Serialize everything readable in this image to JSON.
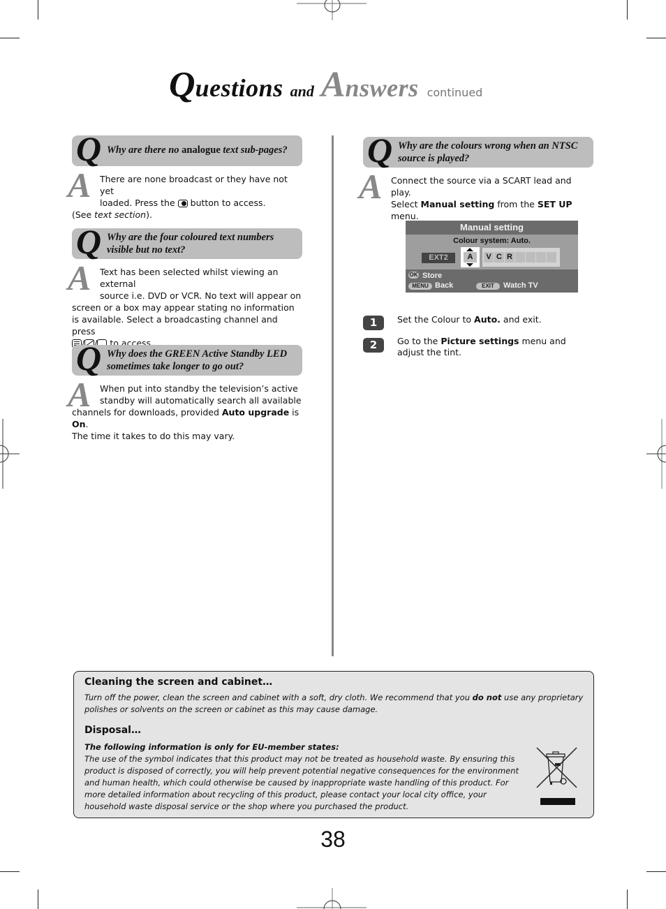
{
  "header": {
    "title_q_initial": "Q",
    "title_q_rest": "uestions",
    "title_and": "and",
    "title_a_initial": "A",
    "title_a_rest": "nswers",
    "title_continued": "continued"
  },
  "left_column": {
    "qa": [
      {
        "q_letter": "Q",
        "question_prefix": "Why are there no ",
        "question_upright": "analogue",
        "question_suffix": " text sub-pages?",
        "a_letter": "A",
        "answer_line1": "There are none broadcast or they have not yet",
        "answer_line2_pre": "loaded. Press the ",
        "answer_icon": "text-button-icon",
        "answer_line2_post": " button to access.",
        "answer_line3_pre": "(See ",
        "answer_line3_italic": "text section",
        "answer_line3_post": ")."
      },
      {
        "q_letter": "Q",
        "question": "Why are the four coloured text numbers visible but no text?",
        "a_letter": "A",
        "answer_line1": "Text has been selected whilst viewing an external",
        "answer_line2": "source i.e. DVD or VCR. No text will appear on",
        "answer_rest": "screen or a box may appear stating no information is available. Select a broadcasting channel and press",
        "answer_icons": [
          "text-icon",
          "mix-icon",
          "tv-icon"
        ],
        "answer_end": " to access."
      },
      {
        "q_letter": "Q",
        "question": "Why does the GREEN Active Standby LED sometimes take longer to go out?",
        "a_letter": "A",
        "answer_line1": "When put into standby the television’s active",
        "answer_line2": "standby will automatically search all available",
        "answer_line3_pre": "channels for downloads, provided ",
        "answer_bold1": "Auto upgrade",
        "answer_mid": " is ",
        "answer_bold2": "On",
        "answer_line3_post": ".",
        "answer_line4": "The time it takes to do this may vary."
      }
    ]
  },
  "right_column": {
    "q_letter": "Q",
    "question": "Why are the colours wrong when an NTSC source is played?",
    "a_letter": "A",
    "answer_line1": "Connect the source via a SCART lead and play.",
    "answer_line2_pre": "Select ",
    "answer_bold1": "Manual setting",
    "answer_mid": " from the ",
    "answer_bold2": "SET UP",
    "answer_post": " menu.",
    "tv_menu": {
      "title": "Manual setting",
      "subtitle": "Colour system: Auto.",
      "source": "EXT2",
      "selected_char": "A",
      "label_chars": [
        "V",
        "C",
        "R",
        "",
        "",
        "",
        ""
      ],
      "ok_key": "OK",
      "ok_label": "Store",
      "menu_key": "MENU",
      "menu_label": "Back",
      "exit_key": "EXIT",
      "exit_label": "Watch TV"
    },
    "steps": [
      {
        "num": "1",
        "pre": "Set the Colour to ",
        "bold": "Auto.",
        "post": " and exit."
      },
      {
        "num": "2",
        "pre": "Go to the ",
        "bold": "Picture settings",
        "post": " menu and adjust the tint."
      }
    ]
  },
  "info_box": {
    "cleaning_heading": "Cleaning the screen and cabinet…",
    "cleaning_pre": "Turn off the power, clean the screen and cabinet with a soft, dry cloth. We recommend that you ",
    "cleaning_bold": "do not",
    "cleaning_post": " use any proprietary polishes or solvents on the screen or cabinet as this may cause damage.",
    "disposal_heading": "Disposal…",
    "disposal_subheading": "The following information is only for EU-member states:",
    "disposal_text": "The use of the symbol indicates that this product may not be treated as household waste. By ensuring this product is disposed of correctly, you will help prevent potential negative consequences for the environment and human health, which could otherwise be caused by inappropriate waste handling of this product. For more detailed information about recycling of this product, please contact your local city office, your household waste disposal service or the shop where you purchased the product.",
    "symbol": "weee-crossed-bin-icon"
  },
  "page_number": "38"
}
